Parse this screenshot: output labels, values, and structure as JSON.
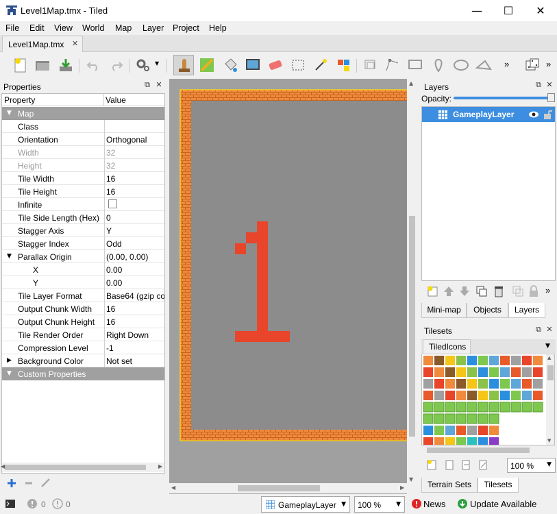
{
  "window": {
    "title": "Level1Map.tmx - Tiled",
    "minimize": "—",
    "maximize": "☐",
    "close": "✕"
  },
  "menu": [
    "File",
    "Edit",
    "View",
    "World",
    "Map",
    "Layer",
    "Project",
    "Help"
  ],
  "tabs": [
    {
      "label": "Level1Map.tmx",
      "close": "✕"
    }
  ],
  "properties_panel": {
    "title": "Properties",
    "col_property": "Property",
    "col_value": "Value",
    "rows": [
      {
        "key": "Map",
        "value": "",
        "type": "group",
        "expander": "▼"
      },
      {
        "key": "Class",
        "value": ""
      },
      {
        "key": "Orientation",
        "value": "Orthogonal"
      },
      {
        "key": "Width",
        "value": "32",
        "disabled": true
      },
      {
        "key": "Height",
        "value": "32",
        "disabled": true
      },
      {
        "key": "Tile Width",
        "value": "16"
      },
      {
        "key": "Tile Height",
        "value": "16"
      },
      {
        "key": "Infinite",
        "value": "",
        "checkbox": true
      },
      {
        "key": "Tile Side Length (Hex)",
        "value": "0"
      },
      {
        "key": "Stagger Axis",
        "value": "Y"
      },
      {
        "key": "Stagger Index",
        "value": "Odd"
      },
      {
        "key": "Parallax Origin",
        "value": "(0.00, 0.00)",
        "expander": "▼"
      },
      {
        "key": "X",
        "value": "0.00",
        "indent": true
      },
      {
        "key": "Y",
        "value": "0.00",
        "indent": true
      },
      {
        "key": "Tile Layer Format",
        "value": "Base64 (gzip co..."
      },
      {
        "key": "Output Chunk Width",
        "value": "16"
      },
      {
        "key": "Output Chunk Height",
        "value": "16"
      },
      {
        "key": "Tile Render Order",
        "value": "Right Down"
      },
      {
        "key": "Compression Level",
        "value": "-1"
      },
      {
        "key": "Background Color",
        "value": "Not set",
        "expander": "▶"
      },
      {
        "key": "Custom Properties",
        "value": "",
        "type": "group",
        "expander": "▼"
      }
    ]
  },
  "layers_panel": {
    "title": "Layers",
    "opacity_label": "Opacity:",
    "opacity": 1.0,
    "layers": [
      {
        "name": "GameplayLayer",
        "visible": true,
        "locked": false
      }
    ],
    "tabs": [
      "Mini-map",
      "Objects",
      "Layers"
    ],
    "active_tab": "Layers"
  },
  "tilesets_panel": {
    "title": "Tilesets",
    "tileset_tab": "TiledIcons",
    "zoom": "100 %",
    "tabs": [
      "Terrain Sets",
      "Tilesets"
    ],
    "active_tab": "Tilesets"
  },
  "statusbar": {
    "errors": "0",
    "warnings": "0",
    "current_layer": "GameplayLayer",
    "zoom": "100 %",
    "news": "News",
    "update": "Update Available"
  },
  "map": {
    "background": "#a0a0a0",
    "border_color": "#f08a3c",
    "glyph_color": "#e8452a",
    "glyph": "1"
  },
  "colors": {
    "selection": "#3d8ee0",
    "group_row": "#a0a0a0"
  }
}
